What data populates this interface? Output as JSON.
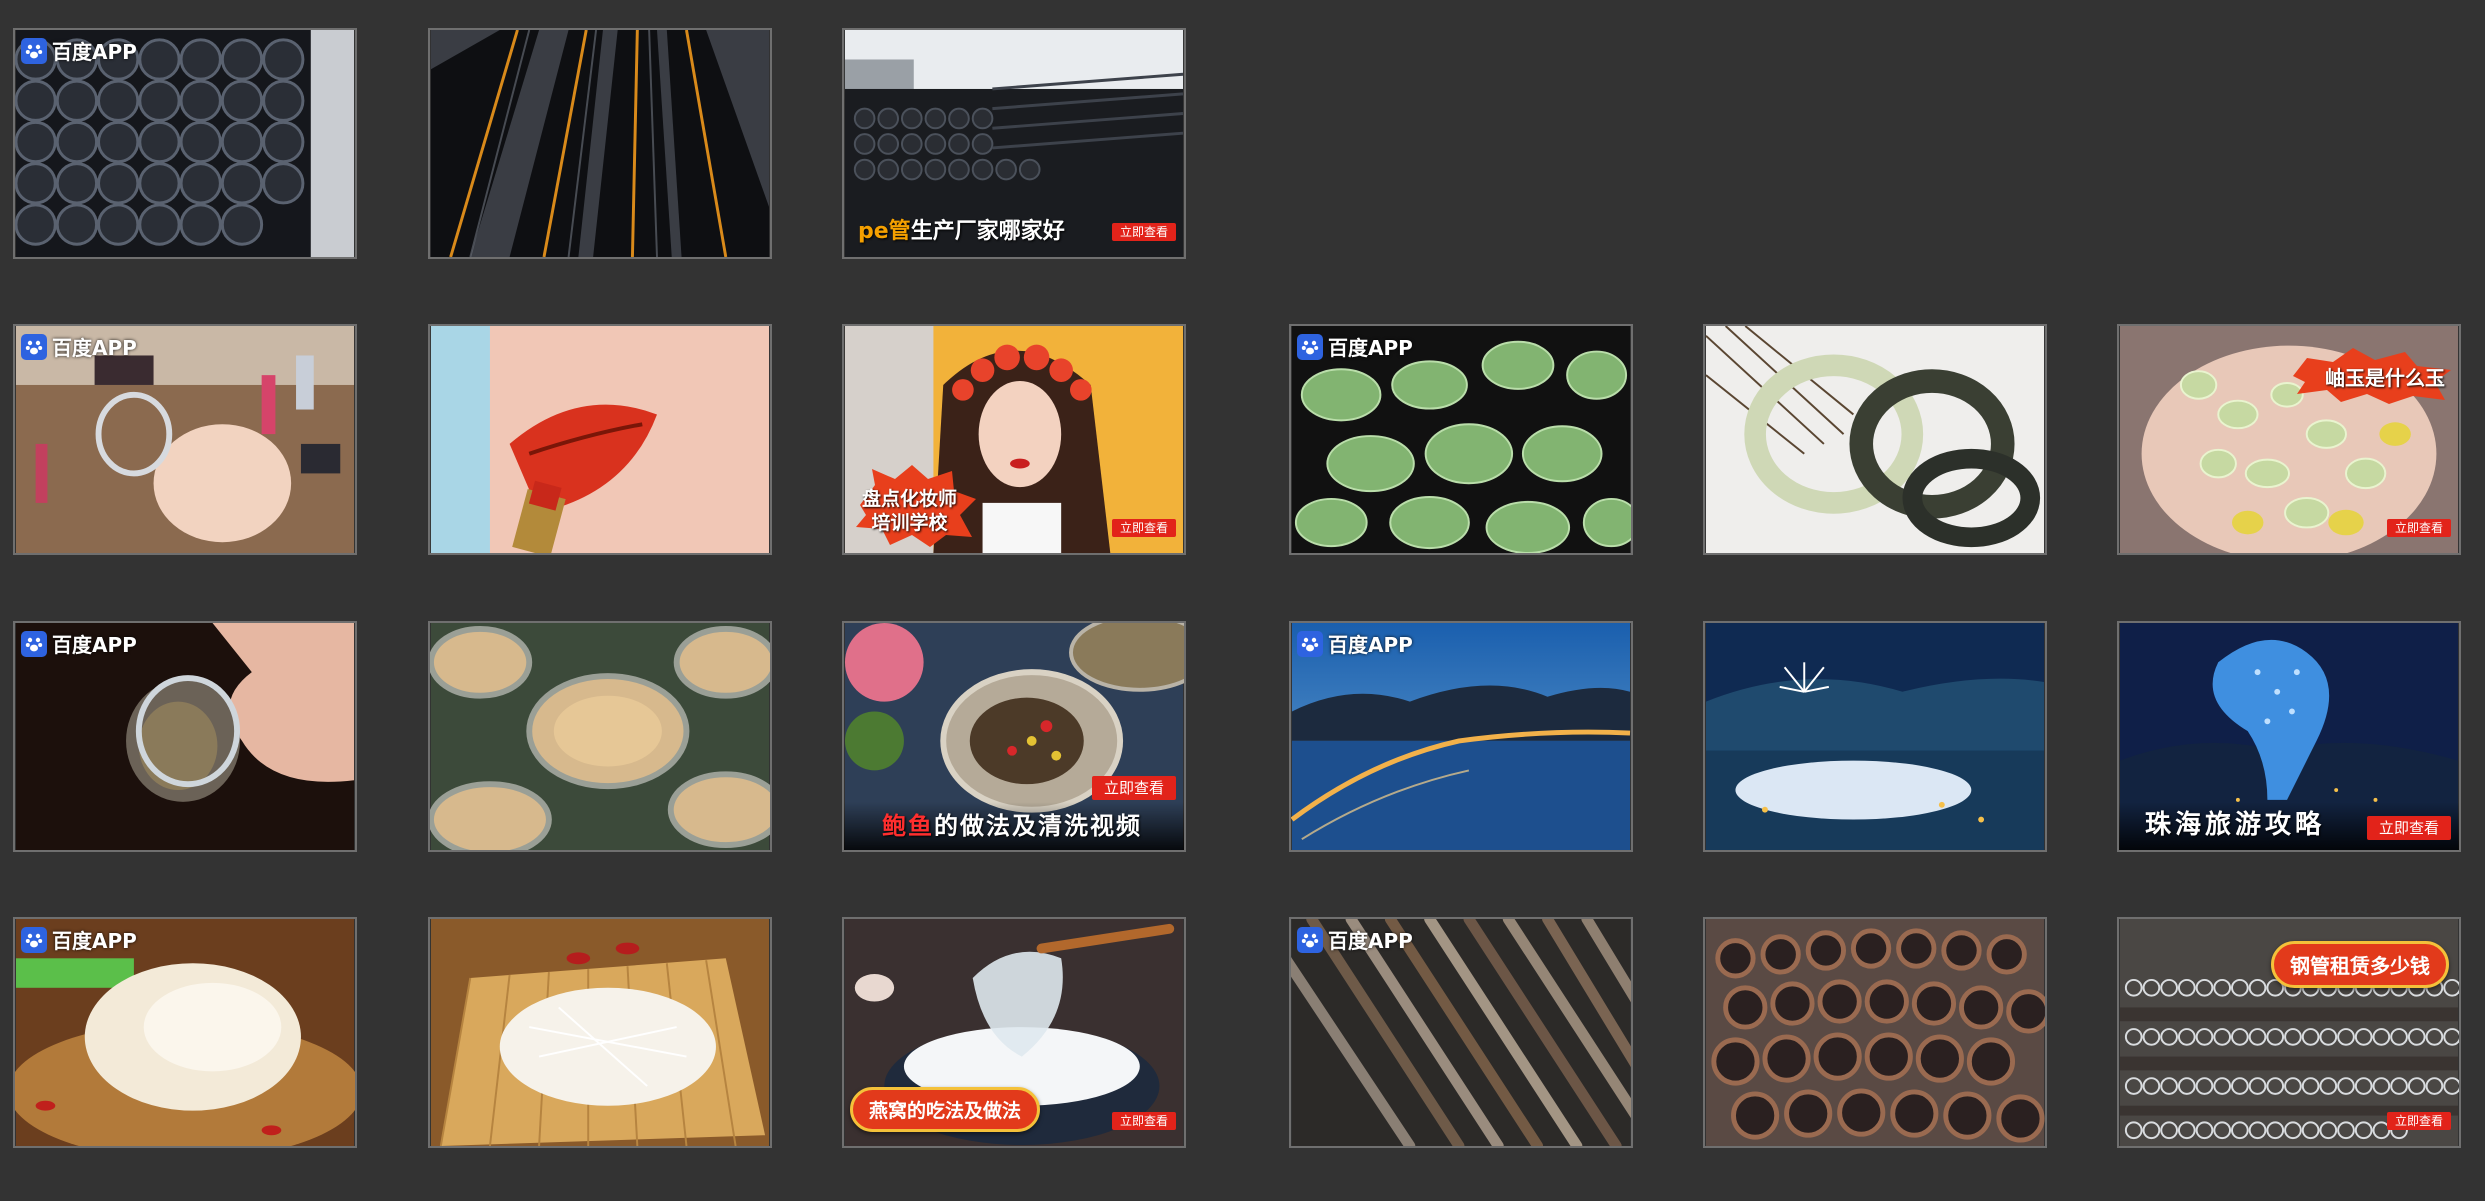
{
  "badge": {
    "text": "百度APP",
    "icon": "baidu-paw-icon"
  },
  "cards": {
    "pe_caption_a": "pe",
    "pe_caption_b": "管",
    "pe_caption_c": "生产厂家哪家好",
    "makeup_line1": "盘点化妆师",
    "makeup_line2": "培训学校",
    "jade_caption": "岫玉是什么玉",
    "abalone_caption_a": "鲍鱼",
    "abalone_caption_b": "的做法及清洗视频",
    "zhuhai_caption": "珠海旅游攻略",
    "birdnest_caption": "燕窝的吃法及做法",
    "steel_caption": "钢管租赁多少钱",
    "cta": "立即查看"
  },
  "colors": {
    "background": "#333333",
    "card_border": "#6f6f6f",
    "cta_red": "#e2231a",
    "accent_orange": "#f5a000",
    "baidu_blue": "#2e63e0"
  }
}
